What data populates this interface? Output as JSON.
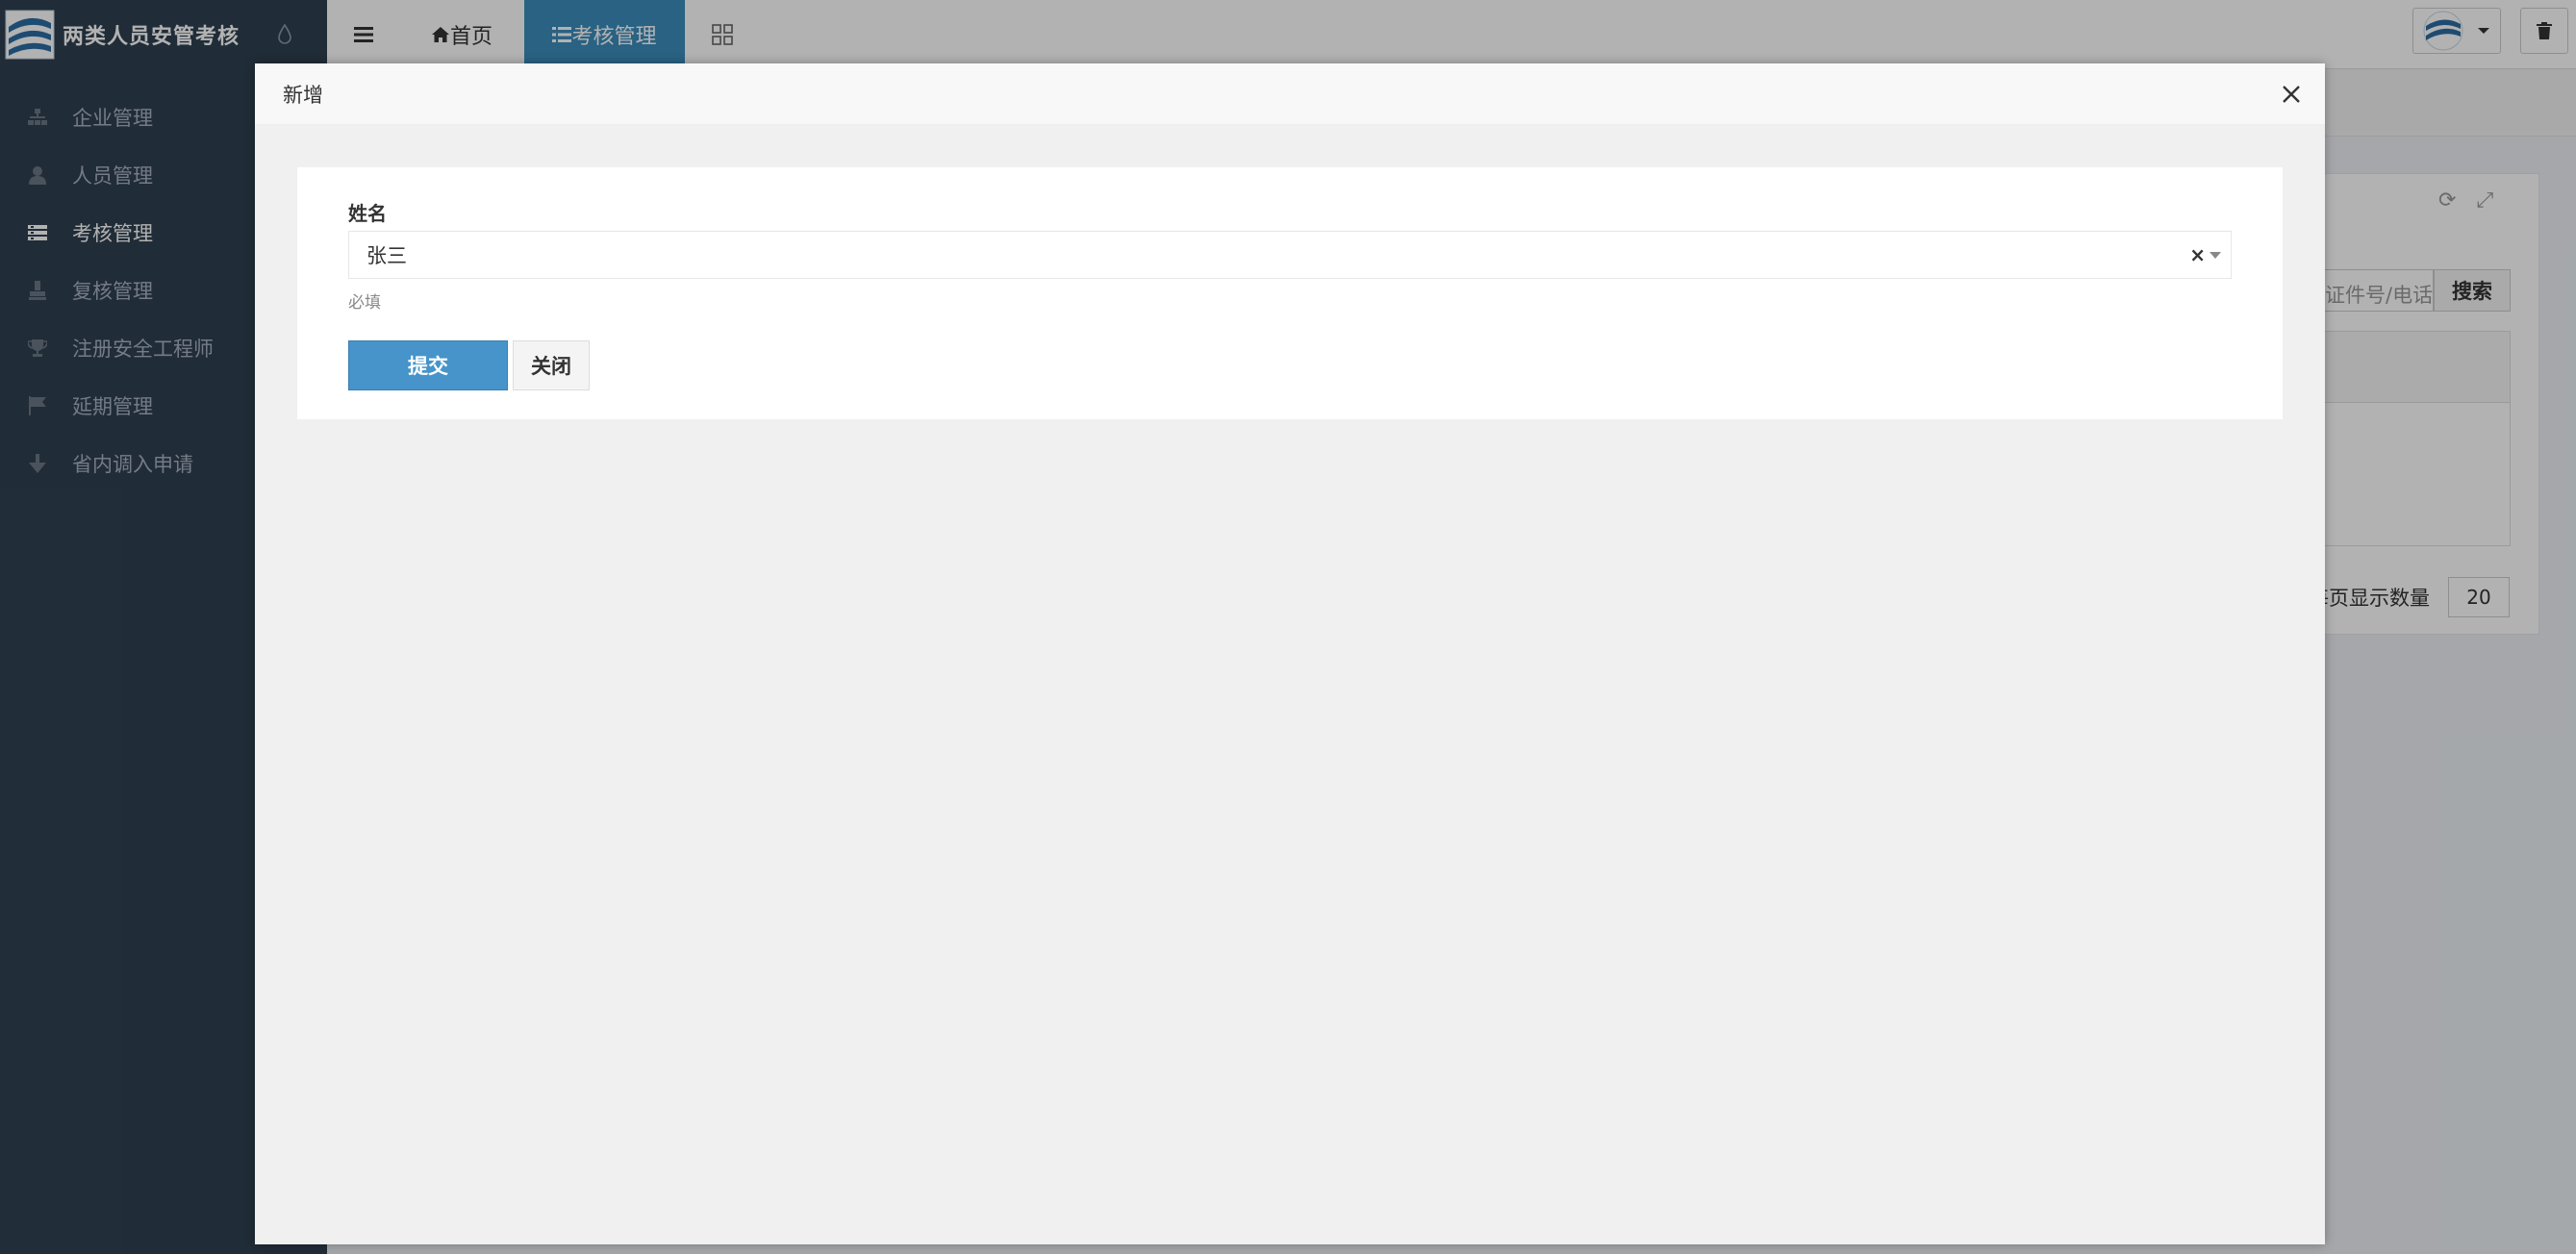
{
  "app": {
    "brand_title": "两类人员安管考核"
  },
  "header": {
    "tabs": [
      {
        "label": "首页",
        "icon": "home-icon"
      },
      {
        "label": "考核管理",
        "icon": "list-icon"
      }
    ]
  },
  "sidebar": {
    "items": [
      {
        "label": "企业管理",
        "icon": "sitemap-icon"
      },
      {
        "label": "人员管理",
        "icon": "user-icon"
      },
      {
        "label": "考核管理",
        "icon": "list-icon",
        "active": true
      },
      {
        "label": "复核管理",
        "icon": "check-stamp-icon"
      },
      {
        "label": "注册安全工程师",
        "icon": "trophy-icon"
      },
      {
        "label": "延期管理",
        "icon": "flag-icon"
      },
      {
        "label": "省内调入申请",
        "icon": "arrow-down-icon"
      }
    ]
  },
  "background": {
    "search_placeholder": "证件号/电话",
    "search_button": "搜索",
    "page_size_label": "每页显示数量",
    "page_size_value": "20"
  },
  "modal": {
    "title": "新增",
    "name_label": "姓名",
    "name_value": "张三",
    "clear_symbol": "×",
    "help_text": "必填",
    "submit_label": "提交",
    "close_label": "关闭"
  },
  "colors": {
    "sidebar_bg": "#2f4050",
    "active_tab": "#3c8dbc",
    "submit_button": "#4694c9"
  }
}
